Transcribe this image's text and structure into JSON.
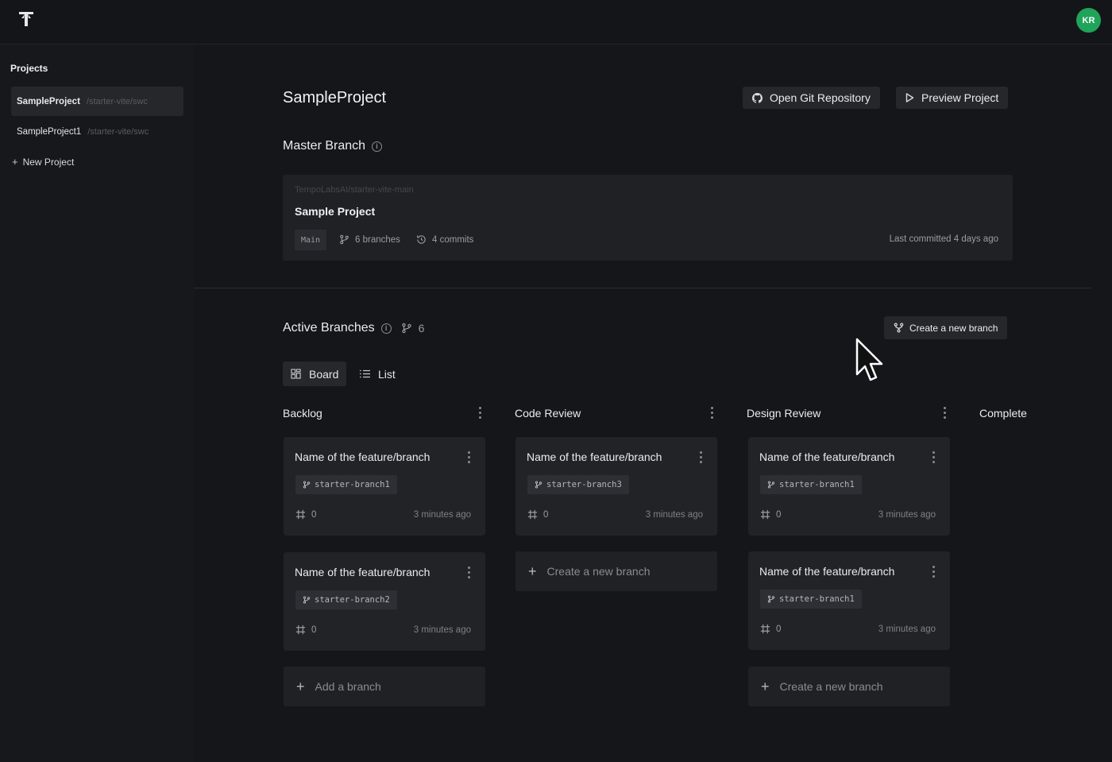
{
  "header": {
    "avatar_initials": "KR",
    "avatar_color": "#1fa45a"
  },
  "sidebar": {
    "title": "Projects",
    "projects": [
      {
        "name": "SampleProject",
        "path": "/starter-vite/swc",
        "active": true
      },
      {
        "name": "SampleProject1",
        "path": "/starter-vite/swc",
        "active": false
      }
    ],
    "new_project_label": "New Project"
  },
  "page": {
    "title": "SampleProject",
    "open_git_label": "Open Git Repository",
    "preview_label": "Preview Project"
  },
  "master": {
    "section_title": "Master Branch",
    "repo_path": "TempoLabsAI/starter-vite-main",
    "project_name": "Sample Project",
    "branch_badge": "Main",
    "branches_count": "6 branches",
    "commits_count": "4 commits",
    "last_committed": "Last committed 4 days ago"
  },
  "active": {
    "section_title": "Active Branches",
    "branch_count": "6",
    "create_label": "Create a new branch",
    "tabs": [
      {
        "label": "Board",
        "active": true
      },
      {
        "label": "List",
        "active": false
      }
    ]
  },
  "columns": [
    {
      "title": "Backlog",
      "cards": [
        {
          "title": "Name of the feature/branch",
          "branch": "starter-branch1",
          "count": "0",
          "time": "3 minutes ago"
        },
        {
          "title": "Name of the feature/branch",
          "branch": "starter-branch2",
          "count": "0",
          "time": "3 minutes ago"
        }
      ],
      "add_label": "Add a branch"
    },
    {
      "title": "Code Review",
      "cards": [
        {
          "title": "Name of the feature/branch",
          "branch": "starter-branch3",
          "count": "0",
          "time": "3 minutes ago"
        }
      ],
      "add_label": "Create a new branch"
    },
    {
      "title": "Design Review",
      "cards": [
        {
          "title": "Name of the feature/branch",
          "branch": "starter-branch1",
          "count": "0",
          "time": "3 minutes ago"
        },
        {
          "title": "Name of the feature/branch",
          "branch": "starter-branch1",
          "count": "0",
          "time": "3 minutes ago"
        }
      ],
      "add_label": "Create a new branch"
    },
    {
      "title": "Complete",
      "cards": []
    }
  ]
}
